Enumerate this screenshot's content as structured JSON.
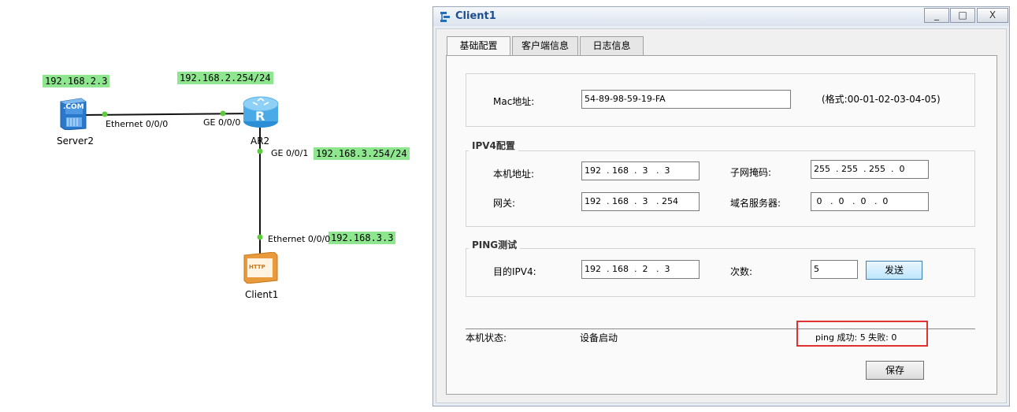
{
  "topology": {
    "devices": {
      "server": "Server2",
      "router": "AR2",
      "client": "Client1"
    },
    "ip_labels": {
      "server_ip": "192.168.2.3",
      "router_ge000": "192.168.2.254/24",
      "router_ge001": "192.168.3.254/24",
      "client_ip": "192.168.3.3"
    },
    "ports": {
      "server_eth": "Ethernet 0/0/0",
      "router_ge000": "GE 0/0/0",
      "router_ge001": "GE 0/0/1",
      "client_eth": "Ethernet 0/0/0"
    },
    "icon_text": {
      "server_badge": ".COM",
      "router_badge": "R",
      "client_badge": "HTTP"
    }
  },
  "window": {
    "title": "Client1",
    "controls": {
      "minimize": "_",
      "maximize": "□",
      "close": "X"
    },
    "tabs": [
      "基础配置",
      "客户端信息",
      "日志信息"
    ],
    "mac": {
      "label": "Mac地址:",
      "value": "54-89-98-59-19-FA",
      "hint": "(格式:00-01-02-03-04-05)"
    },
    "ipv4": {
      "group_title": "IPV4配置",
      "host_label": "本机地址:",
      "host_value": "192  . 168  .  3   .  3",
      "mask_label": "子网掩码:",
      "mask_value": "255  . 255  . 255  .  0",
      "gateway_label": "网关:",
      "gateway_value": "192  . 168  .  3   . 254",
      "dns_label": "域名服务器:",
      "dns_value": " 0   .  0   .  0   .  0"
    },
    "ping": {
      "group_title": "PING测试",
      "dest_label": "目的IPV4:",
      "dest_value": "192  . 168  .  2   .  3",
      "count_label": "次数:",
      "count_value": "5",
      "send_button": "发送"
    },
    "status": {
      "label": "本机状态:",
      "value": "设备启动",
      "result": "ping 成功: 5   失败: 0"
    },
    "save_button": "保存",
    "colors": {
      "highlight_box": "#e03030",
      "ip_label_bg": "#8ee68e",
      "title": "#1b4d8f"
    }
  }
}
